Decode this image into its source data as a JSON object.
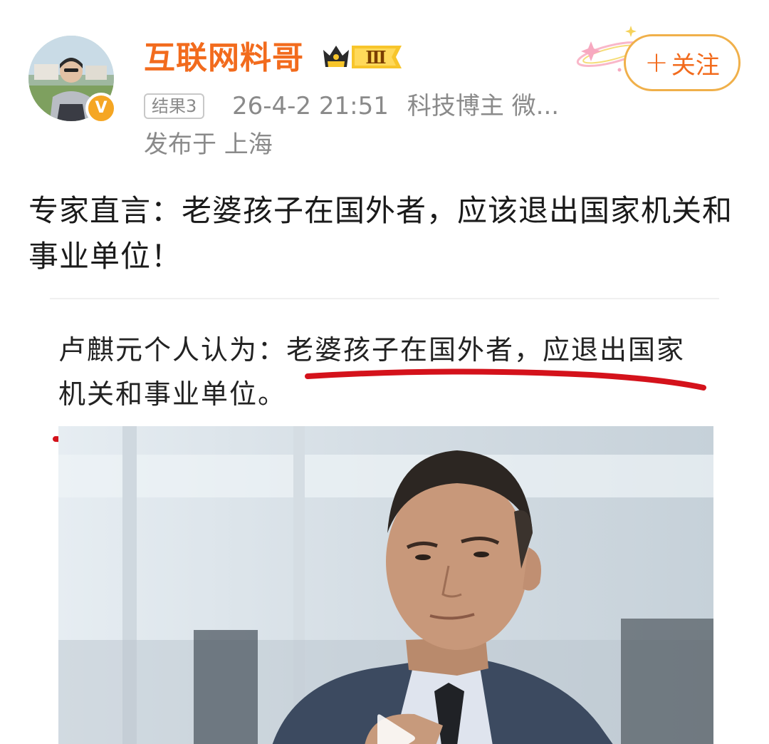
{
  "post": {
    "author": {
      "name": "互联网料哥",
      "verified_badge": "V",
      "vip_level": "Ⅲ"
    },
    "follow_button": {
      "plus": "+",
      "label": "关注"
    },
    "result_tag": "结果3",
    "timestamp": "26-4-2 21:51",
    "author_role": "科技博主 微...",
    "location": "发布于 上海",
    "text": "专家直言：老婆孩子在国外者，应该退出国家机关和事业单位！",
    "image": {
      "caption": "卢麒元个人认为：老婆孩子在国外者，应退出国家机关和事业单位。"
    }
  },
  "colors": {
    "accent": "#f26b1d",
    "follow_border": "#f0b04a",
    "meta_gray": "#8a8a8a",
    "underline_red": "#d4121b"
  },
  "icons": {
    "verified": "verified-v-icon",
    "vip": "crown-vip-icon",
    "play": "play-icon"
  }
}
